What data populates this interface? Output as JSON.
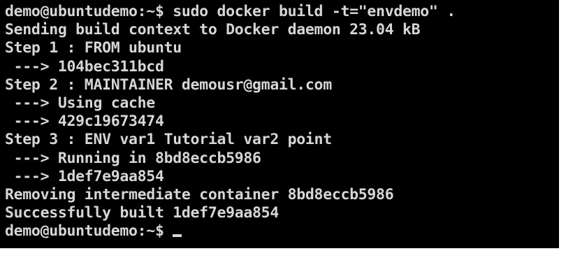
{
  "terminal": {
    "lines": [
      "demo@ubuntudemo:~$ sudo docker build -t=\"envdemo\" .",
      "Sending build context to Docker daemon 23.04 kB",
      "Step 1 : FROM ubuntu",
      " ---> 104bec311bcd",
      "Step 2 : MAINTAINER demousr@gmail.com",
      " ---> Using cache",
      " ---> 429c19673474",
      "Step 3 : ENV var1 Tutorial var2 point",
      " ---> Running in 8bd8eccb5986",
      " ---> 1def7e9aa854",
      "Removing intermediate container 8bd8eccb5986",
      "Successfully built 1def7e9aa854"
    ],
    "prompt": "demo@ubuntudemo:~$"
  },
  "colors": {
    "background": "#000000",
    "foreground": "#d6d6d6"
  }
}
